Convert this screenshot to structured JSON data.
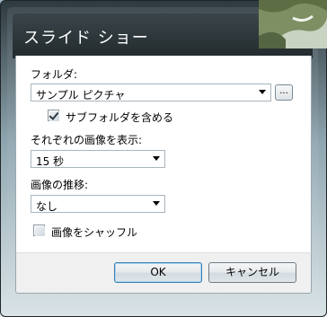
{
  "window": {
    "title": "スライド ショー"
  },
  "folder": {
    "label": "フォルダ:",
    "value": "サンプル ピクチャ",
    "browse_label": "..."
  },
  "subfolders": {
    "label": "サブフォルダを含める",
    "checked": true
  },
  "interval": {
    "label": "それぞれの画像を表示:",
    "value": "15 秒"
  },
  "transition": {
    "label": "画像の推移:",
    "value": "なし"
  },
  "shuffle": {
    "label": "画像をシャッフル",
    "checked": false
  },
  "buttons": {
    "ok": "OK",
    "cancel": "キャンセル"
  }
}
